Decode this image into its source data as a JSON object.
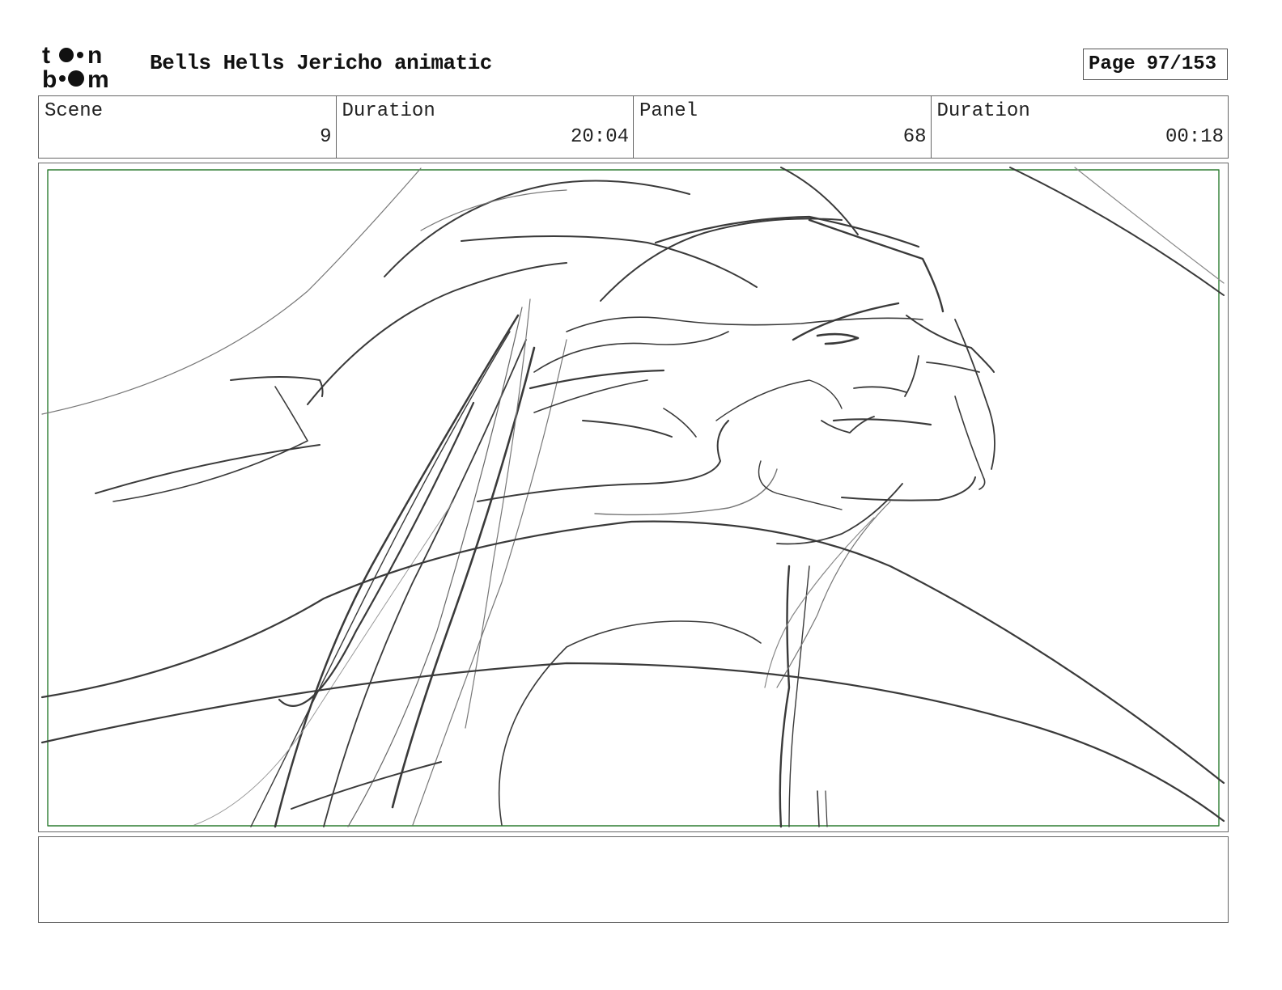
{
  "header": {
    "logo_text": "toon boom",
    "title": "Bells Hells Jericho animatic",
    "page_label": "Page",
    "page_value": "97/153"
  },
  "info": [
    {
      "label": "Scene",
      "value": "9"
    },
    {
      "label": "Duration",
      "value": "20:04"
    },
    {
      "label": "Panel",
      "value": "68"
    },
    {
      "label": "Duration",
      "value": "00:18"
    }
  ],
  "panel": {
    "safe_frame_color": "#2e7d32",
    "sketch_stroke_color": "#3a3a3a"
  },
  "notes": {
    "text": ""
  }
}
